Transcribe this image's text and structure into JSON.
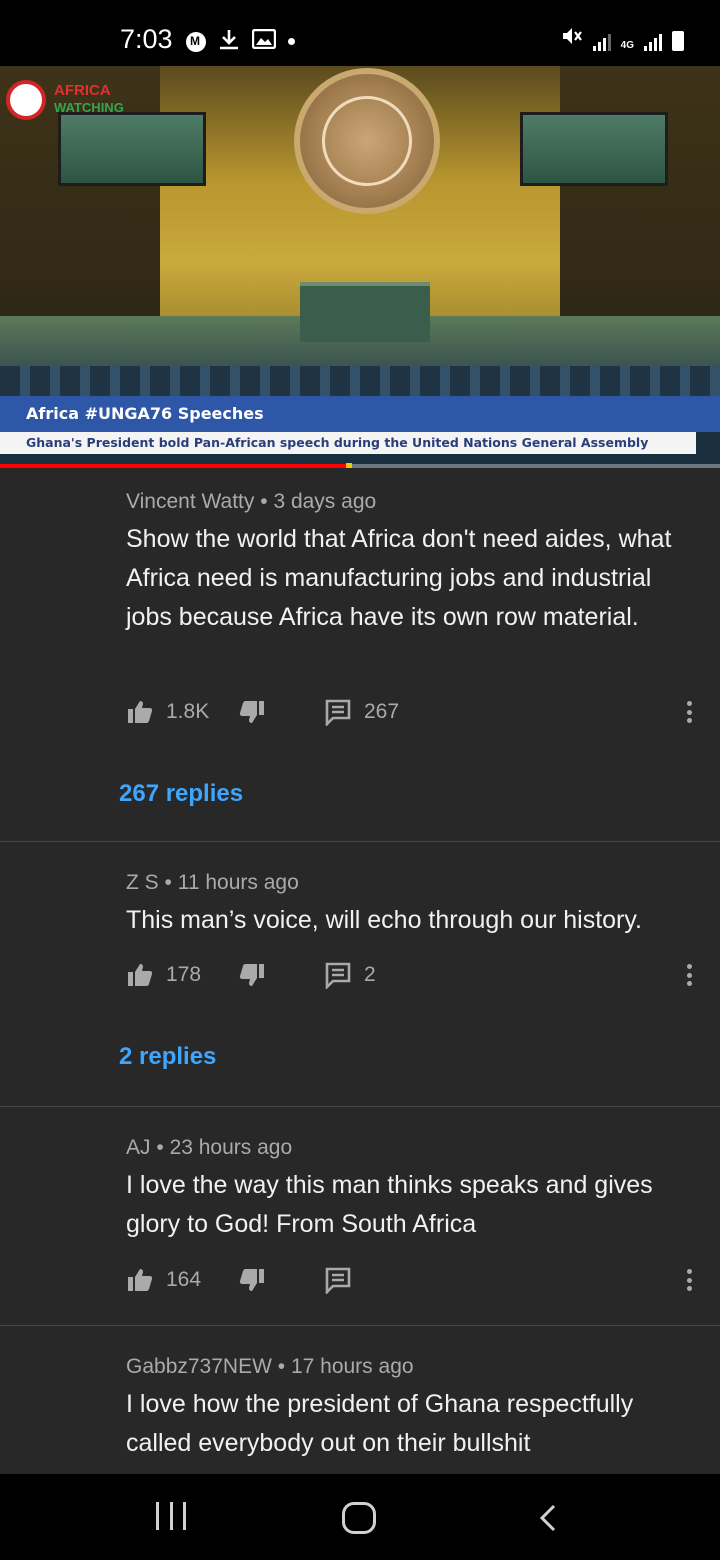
{
  "status_bar": {
    "time": "7:03",
    "left_icons": [
      "messenger-icon",
      "download-icon",
      "image-icon",
      "dot-icon"
    ],
    "right_icons": [
      "mute-icon",
      "signal-icon",
      "4g-icon",
      "signal-icon",
      "battery-icon"
    ],
    "network_label": "4G"
  },
  "video": {
    "channel_logo_text": "AFRICA",
    "channel_logo_subtext": "WATCHING",
    "lower_third_title": "Africa #UNGA76 Speeches",
    "ticker_text": "Ghana's President bold Pan-African speech during the United Nations General Assembly",
    "progress_percent": 48
  },
  "comments": [
    {
      "author": "Vincent Watty",
      "time": "3 days ago",
      "text": "Show the world that Africa don't need aides, what Africa need is manufacturing jobs and industrial jobs because Africa have its own row material.",
      "likes": "1.8K",
      "reply_count": "267",
      "replies_link": "267 replies"
    },
    {
      "author": "Z S",
      "time": "11 hours ago",
      "text": "This man’s voice, will echo through our history.",
      "likes": "178",
      "reply_count": "2",
      "replies_link": "2 replies"
    },
    {
      "author": "AJ",
      "time": "23 hours ago",
      "text": "I love the way this man thinks speaks and gives glory to God! From South Africa",
      "likes": "164",
      "reply_count": "",
      "replies_link": ""
    },
    {
      "author": "Gabbz737NEW",
      "time": "17 hours ago",
      "text": "I love how the president of Ghana respectfully called everybody out on their bullshit",
      "likes": "",
      "reply_count": "",
      "replies_link": ""
    }
  ],
  "meta_separator": "•",
  "colors": {
    "background": "#282828",
    "link": "#3ea6ff",
    "secondary_text": "#aaaaaa",
    "progress": "#ff0000"
  }
}
